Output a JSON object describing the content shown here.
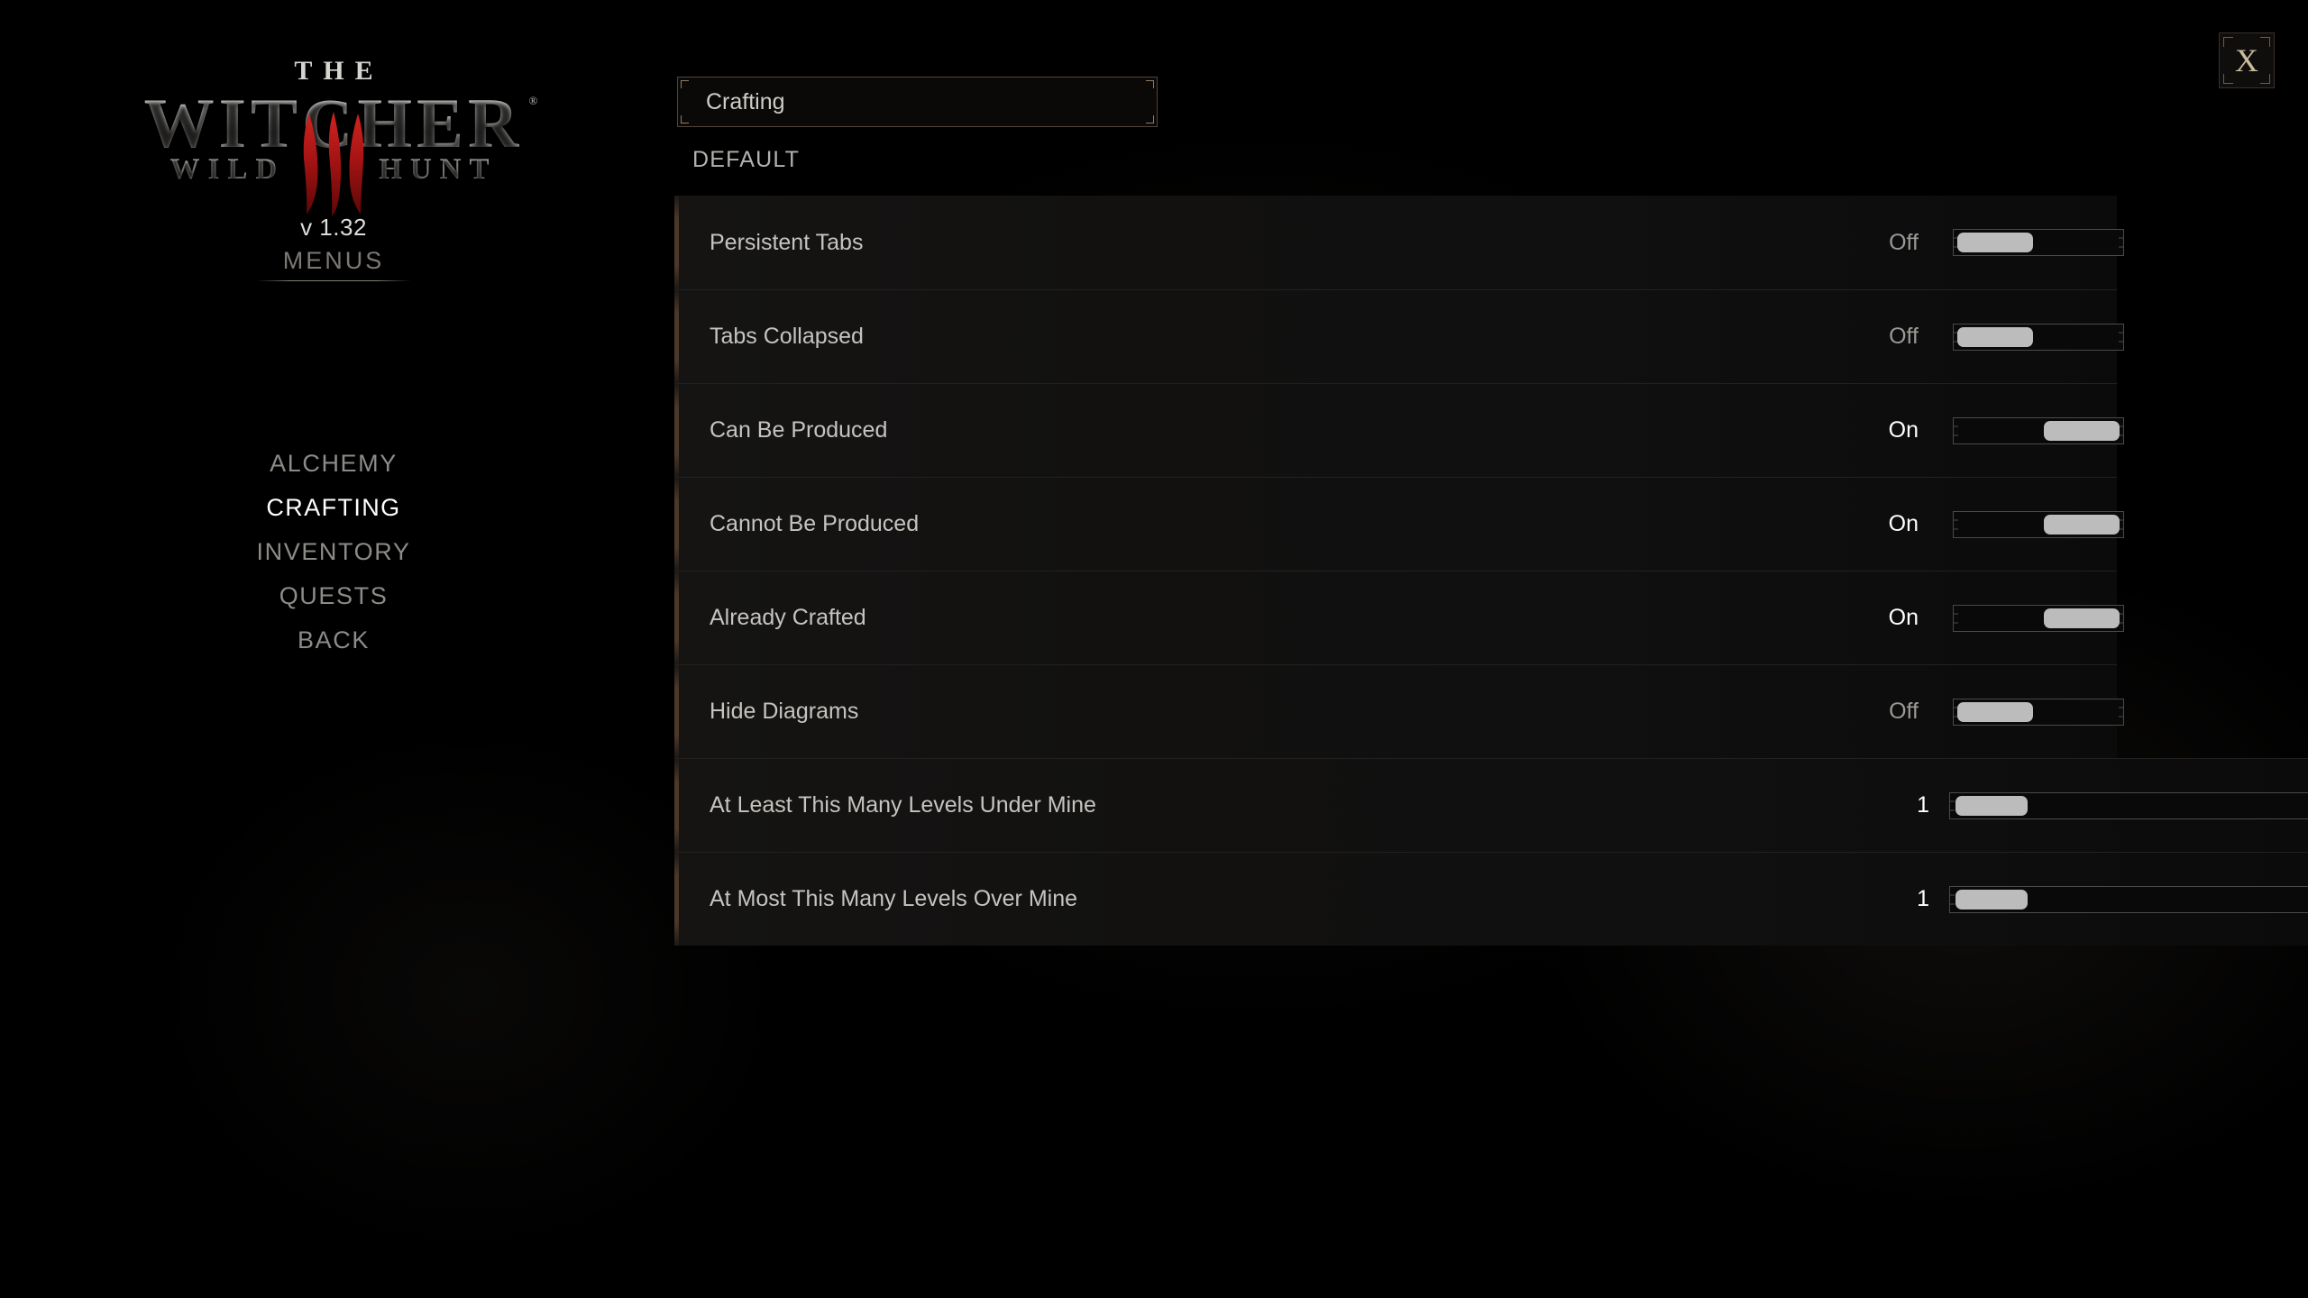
{
  "game": {
    "logo_the": "THE",
    "logo_main": "WITCHER",
    "logo_registered": "®",
    "logo_wild": "WILD",
    "logo_hunt": "HUNT",
    "version": "v 1.32"
  },
  "sidebar": {
    "heading": "MENUS",
    "items": [
      {
        "label": "ALCHEMY",
        "active": false
      },
      {
        "label": "CRAFTING",
        "active": true
      },
      {
        "label": "INVENTORY",
        "active": false
      },
      {
        "label": "QUESTS",
        "active": false
      },
      {
        "label": "BACK",
        "active": false
      }
    ]
  },
  "header": {
    "title": "Crafting",
    "section_label": "DEFAULT",
    "close_label": "X"
  },
  "settings": {
    "rows": [
      {
        "label": "Persistent Tabs",
        "type": "toggle",
        "value": "Off",
        "state": "off"
      },
      {
        "label": "Tabs Collapsed",
        "type": "toggle",
        "value": "Off",
        "state": "off"
      },
      {
        "label": "Can Be Produced",
        "type": "toggle",
        "value": "On",
        "state": "on"
      },
      {
        "label": "Cannot Be Produced",
        "type": "toggle",
        "value": "On",
        "state": "on"
      },
      {
        "label": "Already Crafted",
        "type": "toggle",
        "value": "On",
        "state": "on"
      },
      {
        "label": "Hide Diagrams",
        "type": "toggle",
        "value": "Off",
        "state": "off"
      },
      {
        "label": "At Least This Many Levels Under Mine",
        "type": "slider",
        "value": "1",
        "fill": 0.0
      },
      {
        "label": "At Most This Many Levels Over Mine",
        "type": "slider",
        "value": "1",
        "fill": 0.0
      }
    ]
  },
  "colors": {
    "accent_red": "#b11a1a",
    "accent_gold": "#c9bd9c",
    "frame_brown": "#53433a",
    "text_primary": "#c6c4c0",
    "text_bright": "#ffffff",
    "text_dim": "#8d8b87",
    "knob": "#bcbcbc"
  }
}
